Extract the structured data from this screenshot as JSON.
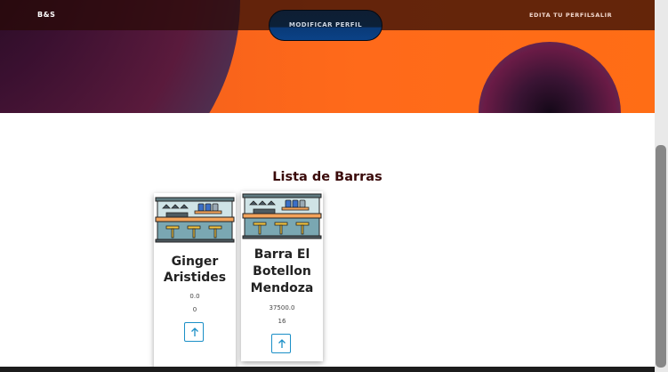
{
  "header": {
    "brand": "B&S",
    "modify_profile_button": "MODIFICAR PERFIL",
    "nav": {
      "edit_profile": "EDITA TU PERFIL",
      "logout": "SALIR"
    }
  },
  "main": {
    "title": "Lista de Barras",
    "bars": [
      {
        "name_line1": "Ginger",
        "name_line2": "Aristides",
        "name_line3": "",
        "value_a": "0.0",
        "value_b": "0"
      },
      {
        "name_line1": "Barra El",
        "name_line2": "Botellon",
        "name_line3": "Mendoza",
        "value_a": "37500.0",
        "value_b": "16"
      }
    ]
  },
  "colors": {
    "hero_orange": "#ff6a1a",
    "title_color": "#3a0a0a",
    "button_outline": "#1b8fc7"
  },
  "icons": {
    "bar_image": "bar-counter-illustration",
    "arrow": "arrow-up-icon"
  }
}
